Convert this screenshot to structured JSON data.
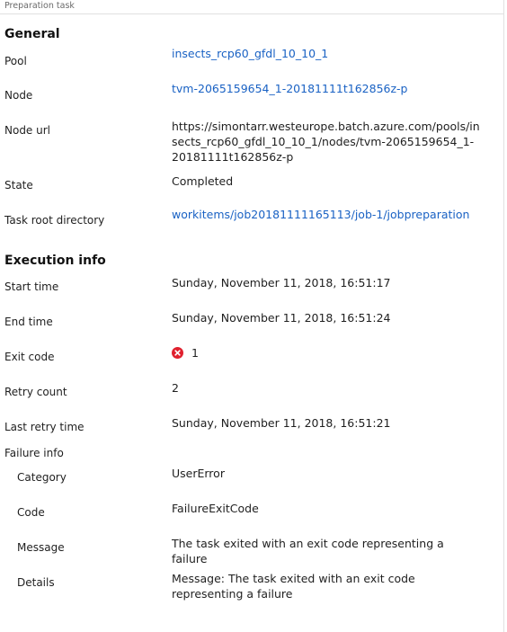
{
  "header": {
    "title": "Preparation task"
  },
  "general": {
    "title": "General",
    "pool": {
      "label": "Pool",
      "value": "insects_rcp60_gfdl_10_10_1"
    },
    "node": {
      "label": "Node",
      "value": "tvm-2065159654_1-20181111t162856z-p"
    },
    "node_url": {
      "label": "Node url",
      "lines": [
        "https://simontarr.westeurope.batch.azure.com/pools/in",
        "sects_rcp60_gfdl_10_10_1/nodes/tvm-2065159654_1-",
        "20181111t162856z-p"
      ]
    },
    "state": {
      "label": "State",
      "value": "Completed"
    },
    "task_root": {
      "label": "Task root directory",
      "value": "workitems/job20181111165113/job-1/jobpreparation"
    }
  },
  "execution": {
    "title": "Execution info",
    "start_time": {
      "label": "Start time",
      "value": "Sunday, November 11, 2018, 16:51:17"
    },
    "end_time": {
      "label": "End time",
      "value": "Sunday, November 11, 2018, 16:51:24"
    },
    "exit_code": {
      "label": "Exit code",
      "value": "1",
      "icon": "error-icon",
      "icon_color": "#e0202e"
    },
    "retry_count": {
      "label": "Retry count",
      "value": "2"
    },
    "last_retry": {
      "label": "Last retry time",
      "value": "Sunday, November 11, 2018, 16:51:21"
    },
    "failure_info": {
      "label": "Failure info",
      "category": {
        "label": "Category",
        "value": "UserError"
      },
      "code": {
        "label": "Code",
        "value": "FailureExitCode"
      },
      "message": {
        "label": "Message",
        "value": "The task exited with an exit code representing a failure"
      },
      "details": {
        "label": "Details",
        "lines": [
          "Message: The task exited with an exit code",
          "representing a failure"
        ]
      }
    }
  },
  "colors": {
    "link": "#1a62c4",
    "error": "#e0202e"
  }
}
